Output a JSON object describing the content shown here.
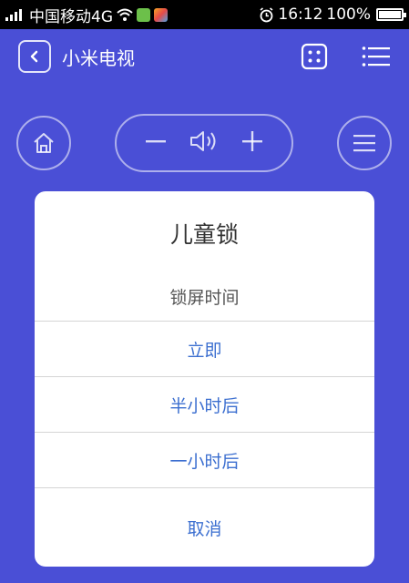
{
  "status_bar": {
    "carrier": "中国移动4G",
    "time": "16:12",
    "battery": "100%",
    "icons": [
      "signal-icon",
      "wifi-icon",
      "wechat-icon",
      "app-icon",
      "alarm-icon",
      "battery-icon"
    ]
  },
  "header": {
    "title": "小米电视",
    "icons": [
      "back-icon",
      "dice-icon",
      "menu-icon"
    ]
  },
  "controls": {
    "icons": [
      "home-icon",
      "volume-down-icon",
      "volume-icon",
      "volume-up-icon",
      "menu-circle-icon"
    ]
  },
  "dialog": {
    "title": "儿童锁",
    "subtitle": "锁屏时间",
    "options": [
      "立即",
      "半小时后",
      "一小时后"
    ],
    "cancel_label": "取消"
  },
  "colors": {
    "background": "#4a4fd6",
    "dialog_bg": "#ffffff",
    "option_text": "#3c6fd0",
    "title_text": "#333333"
  }
}
